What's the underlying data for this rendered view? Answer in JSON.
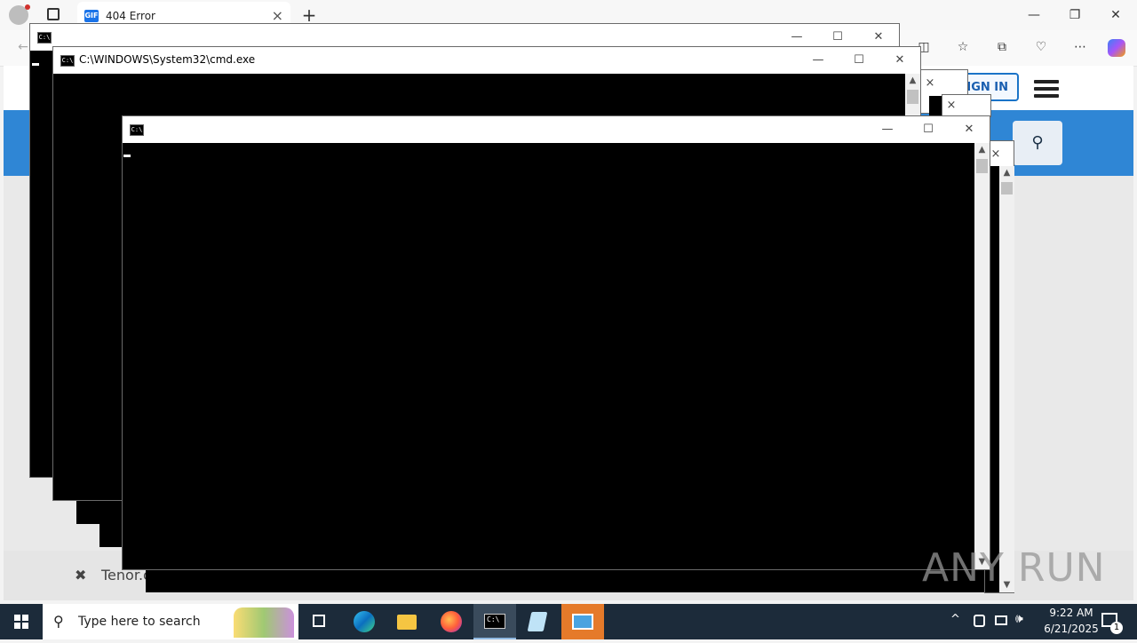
{
  "browser": {
    "tab_title": "404 Error",
    "tab_favicon": "GIF",
    "new_tab_glyph": "+",
    "toolbar_icons": [
      "split-screen-icon",
      "favorites-icon",
      "collections-icon",
      "browser-essentials-icon",
      "more-icon",
      "copilot-icon"
    ]
  },
  "webpage": {
    "signin_label": "SIGN IN",
    "footer_text": "Tenor.c",
    "footer_close_glyph": "✖"
  },
  "windows": {
    "cmd_main_title": "C:\\WINDOWS\\System32\\cmd.exe",
    "cmd_back_title": "",
    "cmd_front_title": ""
  },
  "taskbar": {
    "search_placeholder": "Type here to search",
    "time": "9:22 AM",
    "date": "6/21/2025",
    "notification_count": "1"
  },
  "watermark": "ANY RUN",
  "colors": {
    "taskbar": "#1c2b3a",
    "site_band": "#2f86d5",
    "console": "#000000"
  }
}
